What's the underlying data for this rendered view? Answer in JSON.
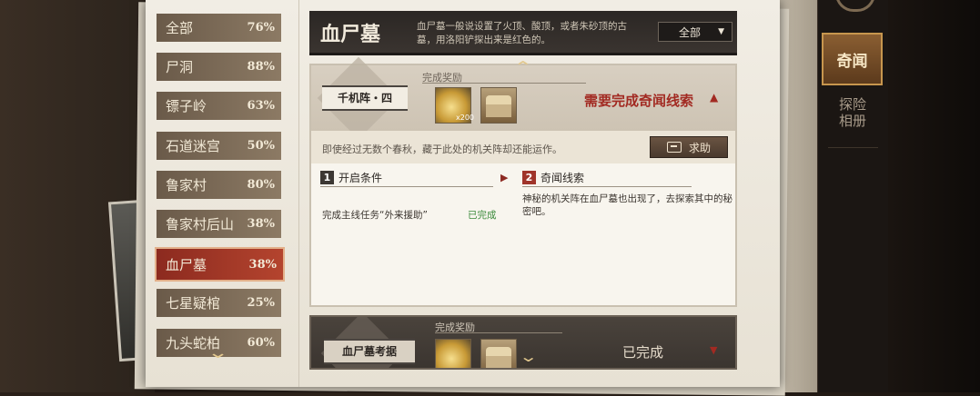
{
  "locations": [
    {
      "name": "全部",
      "pct": "76%"
    },
    {
      "name": "尸洞",
      "pct": "88%"
    },
    {
      "name": "镖子岭",
      "pct": "63%"
    },
    {
      "name": "石道迷宫",
      "pct": "50%"
    },
    {
      "name": "鲁家村",
      "pct": "80%"
    },
    {
      "name": "鲁家村后山",
      "pct": "38%"
    },
    {
      "name": "血尸墓",
      "pct": "38%"
    },
    {
      "name": "七星疑棺",
      "pct": "25%"
    },
    {
      "name": "九头蛇柏",
      "pct": "60%"
    }
  ],
  "header": {
    "title": "血尸墓",
    "description": "血尸墓一般说设置了火顶、酸顶，或者朱砂顶的古墓，用洛阳铲探出来是红色的。",
    "filter": "全部"
  },
  "quest1": {
    "name": "千机阵・四",
    "reward_label": "完成奖励",
    "reward_count": "x200",
    "status": "需要完成奇闻线索",
    "intro": "即使经过无数个春秋，藏于此处的机关阵却还能运作。",
    "help_label": "求助",
    "step1": {
      "num": "1",
      "title": "开启条件",
      "condition": "完成主线任务“外来援助”",
      "condition_status": "已完成"
    },
    "step2": {
      "num": "2",
      "title": "奇闻线索",
      "text": "神秘的机关阵在血尸墓也出现了，去探索其中的秘密吧。"
    }
  },
  "quest2": {
    "name": "血尸墓考据",
    "reward_label": "完成奖励",
    "status": "已完成"
  },
  "side_tabs": {
    "active": "奇闻",
    "album": "探险\n相册"
  },
  "colors": {
    "accent_red": "#a22a22",
    "active_item": "#b4442e",
    "complete_green": "#3a8a3a"
  }
}
